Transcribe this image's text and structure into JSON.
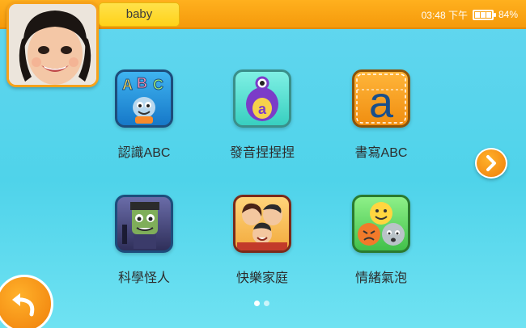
{
  "status_bar": {
    "user_name": "baby",
    "time": "03:48 下午",
    "battery": "84%",
    "battery_level": 0.84
  },
  "apps": [
    {
      "label": "認識ABC",
      "icon": "abc-monster-icon"
    },
    {
      "label": "發音捏捏捏",
      "icon": "purple-a-monster-icon"
    },
    {
      "label": "書寫ABC",
      "icon": "letter-a-writing-icon"
    },
    {
      "label": "科學怪人",
      "icon": "frankenstein-icon"
    },
    {
      "label": "快樂家庭",
      "icon": "happy-family-icon"
    },
    {
      "label": "情緒氣泡",
      "icon": "emotion-bubbles-icon"
    }
  ],
  "pagination": {
    "pages": 2,
    "current": 1
  },
  "colors": {
    "header": "#f7a21a",
    "name_badge": "#ffd21a",
    "background": "#5ad6ec",
    "accent_button": "#f58d12"
  }
}
